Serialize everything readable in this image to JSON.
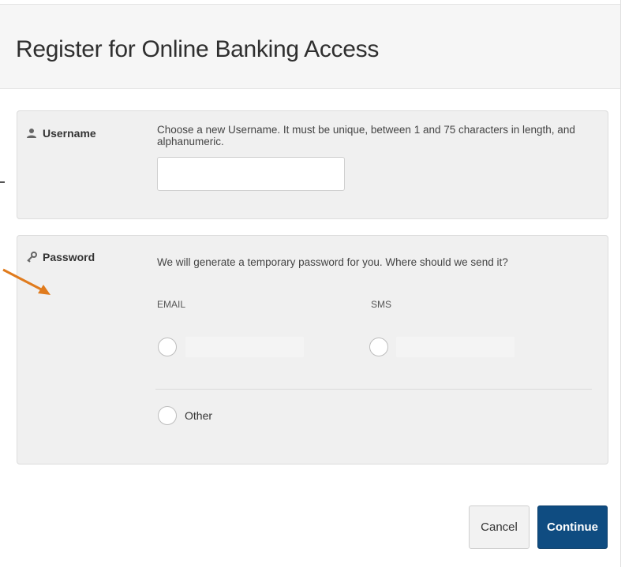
{
  "header": {
    "title": "Register for Online Banking Access"
  },
  "username": {
    "label": "Username",
    "icon": "user-icon",
    "help": "Choose a new Username. It must be unique, between 1 and 75 characters in length, and alphanumeric.",
    "value": ""
  },
  "password": {
    "label": "Password",
    "icon": "key-icon",
    "help": "We will generate a temporary password for you. Where should we send it?",
    "options": {
      "email": "EMAIL",
      "sms": "SMS",
      "other": "Other"
    }
  },
  "actions": {
    "cancel": "Cancel",
    "continue": "Continue"
  },
  "colors": {
    "primary": "#0f4c81",
    "annotation_arrow": "#e07b1d"
  }
}
